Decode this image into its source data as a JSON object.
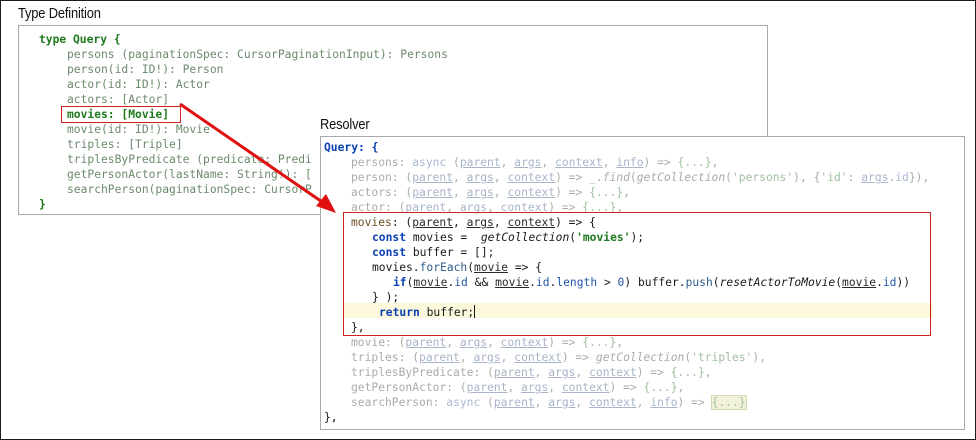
{
  "type_definition": {
    "title": "Type Definition",
    "lines": [
      "type Query {",
      "persons (paginationSpec: CursorPaginationInput): Persons",
      "person(id: ID!): Person",
      "actor(id: ID!): Actor",
      "actors: [Actor]",
      "movies: [Movie]",
      "movie(id: ID!): Movie",
      "triples: [Triple]",
      "triplesByPredicate (predicate: Predi",
      "getPersonActor(lastName: String!): [",
      "searchPerson(paginationSpec: CursorP",
      "}"
    ]
  },
  "resolver": {
    "title": "Resolver",
    "query_open": "Query: {",
    "query_close": "},",
    "lines": {
      "persons": [
        "persons",
        ": ",
        "async",
        " (",
        "parent",
        ", ",
        "args",
        ", ",
        "context",
        ", ",
        "info",
        ") => ",
        "{...}",
        ","
      ],
      "person": [
        "person",
        ": (",
        "parent",
        ", ",
        "args",
        ", ",
        "context",
        ") => _.",
        "find",
        "(",
        "getCollection",
        "(",
        "'persons'",
        "), {",
        "'id'",
        ": ",
        "args",
        ".",
        "id",
        "}),"
      ],
      "actors": [
        "actors",
        ": (",
        "parent",
        ", ",
        "args",
        ", ",
        "context",
        ") => ",
        "{...}",
        ","
      ],
      "actor": [
        "actor",
        ": (",
        "parent",
        ", ",
        "args",
        ", ",
        "context",
        ") => ",
        "{...}",
        ","
      ],
      "movies_head": [
        "movies",
        ": (",
        "parent",
        ", ",
        "args",
        ", ",
        "context",
        ") => {"
      ],
      "const_movies": [
        "const",
        " movies = ",
        "getCollection",
        "(",
        "'movies'",
        ");"
      ],
      "const_buffer": [
        "const",
        " buffer = [];"
      ],
      "foreach": [
        "movies.",
        "forEach",
        "(",
        "movie",
        " => {"
      ],
      "if_line": [
        "if",
        "(",
        "movie",
        ".",
        "id",
        " && ",
        "movie",
        ".",
        "id",
        ".",
        "length",
        " > ",
        "0",
        ") buffer.",
        "push",
        "(",
        "resetActorToMovie",
        "(",
        "movie",
        ".",
        "id",
        "))"
      ],
      "close_foreach": "} );",
      "return_line": [
        "return",
        " buffer;"
      ],
      "close_movies": "},",
      "movie": [
        "movie",
        ": (",
        "parent",
        ", ",
        "args",
        ", ",
        "context",
        ") => ",
        "{...}",
        ","
      ],
      "triples": [
        "triples",
        ": (",
        "parent",
        ", ",
        "args",
        ", ",
        "context",
        ") => ",
        "getCollection",
        "(",
        "'triples'",
        "),"
      ],
      "triplesByPredicate": [
        "triplesByPredicate",
        ": (",
        "parent",
        ", ",
        "args",
        ", ",
        "context",
        ") => ",
        "{...}",
        ","
      ],
      "getPersonActor": [
        "getPersonActor",
        ": (",
        "parent",
        ", ",
        "args",
        ", ",
        "context",
        ") => ",
        "{...}",
        ","
      ],
      "searchPerson": [
        "searchPerson",
        ": ",
        "async",
        " (",
        "parent",
        ", ",
        "args",
        ", ",
        "context",
        ", ",
        "info",
        ") => ",
        "{...}"
      ]
    }
  },
  "colors": {
    "highlight_border": "#d02020",
    "arrow": "#e01010",
    "keyword": "#0b3fb5",
    "string": "#1e7a1e"
  }
}
